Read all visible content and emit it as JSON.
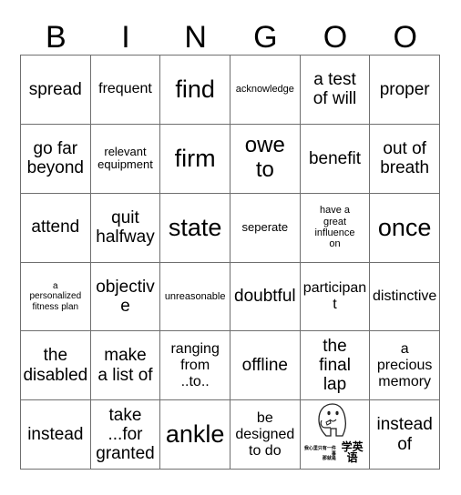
{
  "card": {
    "title_letters": [
      "B",
      "I",
      "N",
      "G",
      "O",
      "O"
    ],
    "columns": 6,
    "rows": 6,
    "border_color": "#6f6f6f",
    "background": "#ffffff",
    "text_color": "#000000"
  },
  "cells": [
    {
      "text": "spread",
      "size": "md",
      "r": 1,
      "c": 1
    },
    {
      "text": "frequent",
      "size": "sm",
      "r": 1,
      "c": 2
    },
    {
      "text": "find",
      "size": "xl",
      "r": 1,
      "c": 3
    },
    {
      "text": "acknowledge",
      "size": "xxs",
      "r": 1,
      "c": 4
    },
    {
      "text": "a test\nof will",
      "size": "md",
      "r": 1,
      "c": 5
    },
    {
      "text": "proper",
      "size": "md",
      "r": 1,
      "c": 6
    },
    {
      "text": "go far\nbeyond",
      "size": "md",
      "r": 2,
      "c": 1
    },
    {
      "text": "relevant\nequipment",
      "size": "xs",
      "r": 2,
      "c": 2
    },
    {
      "text": "firm",
      "size": "xl",
      "r": 2,
      "c": 3
    },
    {
      "text": "owe\nto",
      "size": "lg",
      "r": 2,
      "c": 4
    },
    {
      "text": "benefit",
      "size": "md",
      "r": 2,
      "c": 5
    },
    {
      "text": "out of\nbreath",
      "size": "md",
      "r": 2,
      "c": 6
    },
    {
      "text": "attend",
      "size": "md",
      "r": 3,
      "c": 1
    },
    {
      "text": "quit\nhalfway",
      "size": "md",
      "r": 3,
      "c": 2
    },
    {
      "text": "state",
      "size": "xl",
      "r": 3,
      "c": 3
    },
    {
      "text": "seperate",
      "size": "xs",
      "r": 3,
      "c": 4
    },
    {
      "text": "have a\ngreat\ninfluence\non",
      "size": "xxs",
      "r": 3,
      "c": 5
    },
    {
      "text": "once",
      "size": "xl",
      "r": 3,
      "c": 6
    },
    {
      "text": "a\npersonalized\nfitness plan",
      "size": "tiny",
      "r": 4,
      "c": 1
    },
    {
      "text": "objective",
      "size": "md",
      "r": 4,
      "c": 2
    },
    {
      "text": "unreasonable",
      "size": "xxs",
      "r": 4,
      "c": 3
    },
    {
      "text": "doubtful",
      "size": "md",
      "r": 4,
      "c": 4
    },
    {
      "text": "participant",
      "size": "sm",
      "r": 4,
      "c": 5
    },
    {
      "text": "distinctive",
      "size": "sm",
      "r": 4,
      "c": 6
    },
    {
      "text": "the\ndisabled",
      "size": "md",
      "r": 5,
      "c": 1
    },
    {
      "text": "make\na list of",
      "size": "md",
      "r": 5,
      "c": 2
    },
    {
      "text": "ranging\nfrom\n..to..",
      "size": "sm",
      "r": 5,
      "c": 3
    },
    {
      "text": "offline",
      "size": "md",
      "r": 5,
      "c": 4
    },
    {
      "text": "the\nfinal\nlap",
      "size": "md",
      "r": 5,
      "c": 5
    },
    {
      "text": "a\nprecious\nmemory",
      "size": "sm",
      "r": 5,
      "c": 6
    },
    {
      "text": "instead",
      "size": "md",
      "r": 6,
      "c": 1
    },
    {
      "text": "take\n...for\ngranted",
      "size": "md",
      "r": 6,
      "c": 2
    },
    {
      "text": "ankle",
      "size": "xl",
      "r": 6,
      "c": 3
    },
    {
      "text": "be\ndesigned\nto do",
      "size": "sm",
      "r": 6,
      "c": 4
    },
    {
      "type": "image",
      "r": 6,
      "c": 5,
      "image_name": "ghost-study-english-meme",
      "caption_small": "我心里只有一件事\n那就是",
      "caption_big": "学英语"
    },
    {
      "text": "instead\nof",
      "size": "md",
      "r": 6,
      "c": 6
    }
  ]
}
